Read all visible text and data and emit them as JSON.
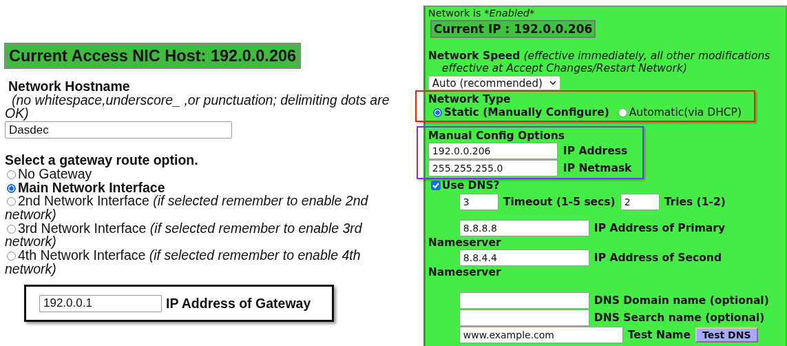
{
  "host_banner": "Current Access NIC Host: 192.0.0.206",
  "hostname": {
    "label": "Network Hostname",
    "hint": "(no whitespace,underscore_ ,or punctuation; delimiting dots are OK)",
    "value": "Dasdec"
  },
  "gateway": {
    "heading": "Select a gateway route option.",
    "options": [
      {
        "label": "No Gateway",
        "selected": false
      },
      {
        "label": "Main Network Interface",
        "selected": true
      },
      {
        "label": "2nd Network Interface",
        "note": "(if selected remember to enable 2nd",
        "note_line_2": "network)",
        "selected": false
      },
      {
        "label": "3rd Network Interface",
        "note": "(if selected remember to enable 3rd",
        "note_line_2": "network)",
        "selected": false
      },
      {
        "label": "4th Network Interface",
        "note": "(if selected remember to enable 4th",
        "note_line_2": "network)",
        "selected": false
      }
    ],
    "ip_value": "192.0.0.1",
    "ip_label": "IP Address of Gateway"
  },
  "network": {
    "status_label": "Network is",
    "status_value": "*Enabled*",
    "current_ip": "Current IP : 192.0.0.206",
    "speed": {
      "label": "Network Speed",
      "note": "(effective immediately, all other modifications effective at Accept Changes/Restart Network)",
      "value": "Auto (recommended)"
    },
    "type": {
      "heading": "Network Type",
      "options": [
        {
          "label": "Static (Manually Configure)",
          "selected": true
        },
        {
          "label": "Automatic(via DHCP)",
          "selected": false
        }
      ]
    },
    "manual": {
      "heading": "Manual Config Options",
      "fields": [
        {
          "value": "192.0.0.206",
          "label": "IP Address"
        },
        {
          "value": "255.255.255.0",
          "label": "IP Netmask"
        }
      ]
    },
    "dns": {
      "label": "Use DNS?",
      "checked": true,
      "timeout_value": "3",
      "timeout_label": "Timeout (1-5 secs)",
      "tries_value": "2",
      "tries_label": "Tries (1-2)",
      "nameservers": [
        {
          "value": "8.8.8.8",
          "label": "IP Address of Primary",
          "label_line_2": "Nameserver"
        },
        {
          "value": "8.8.4.4",
          "label": "IP Address of Second",
          "label_line_2": "Nameserver"
        }
      ],
      "names": [
        {
          "label": "DNS Domain name (optional)"
        },
        {
          "label": "DNS Search name (optional)"
        }
      ],
      "test_value": "www.example.com",
      "test_label": "Test Name",
      "test_button": "Test DNS"
    }
  }
}
